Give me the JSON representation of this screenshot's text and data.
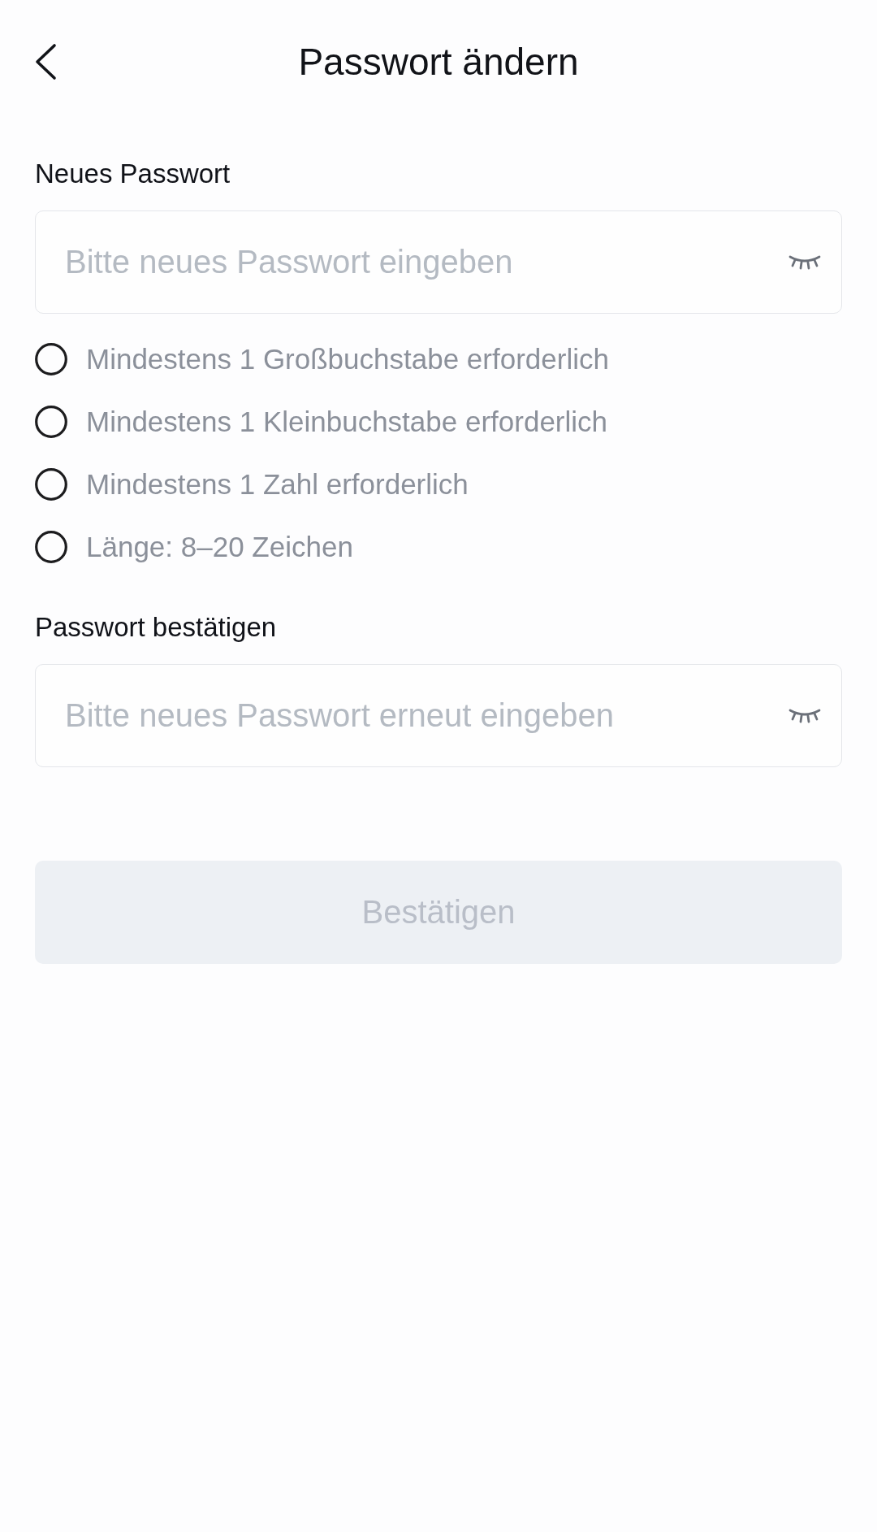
{
  "header": {
    "title": "Passwort ändern"
  },
  "new_password": {
    "label": "Neues Passwort",
    "placeholder": "Bitte neues Passwort eingeben",
    "visible": false
  },
  "requirements": [
    {
      "text": "Mindestens 1 Großbuchstabe erforderlich",
      "checked": false
    },
    {
      "text": "Mindestens 1 Kleinbuchstabe erforderlich",
      "checked": false
    },
    {
      "text": "Mindestens 1 Zahl erforderlich",
      "checked": false
    },
    {
      "text": "Länge: 8–20 Zeichen",
      "checked": false
    }
  ],
  "confirm_password": {
    "label": "Passwort bestätigen",
    "placeholder": "Bitte neues Passwort erneut eingeben",
    "visible": false
  },
  "submit_button": {
    "label": "Bestätigen",
    "disabled": true
  }
}
